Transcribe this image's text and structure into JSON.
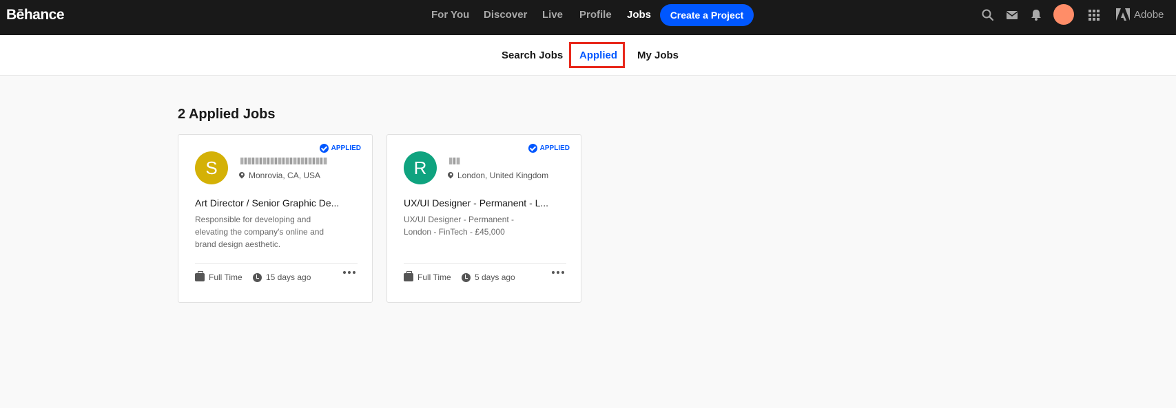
{
  "topbar": {
    "logo": "Bēhance",
    "nav": [
      "For You",
      "Discover",
      "Live",
      "Profile",
      "Jobs"
    ],
    "create_label": "Create a Project",
    "adobe_label": "Adobe",
    "colors": {
      "bg": "#191919",
      "accent": "#0057ff",
      "avatar": "#ff8d68"
    }
  },
  "subnav": {
    "items": [
      "Search Jobs",
      "Applied",
      "My Jobs"
    ],
    "active": "Applied"
  },
  "main": {
    "heading": "2 Applied Jobs",
    "cards": [
      {
        "badge": "APPLIED",
        "avatar_letter": "S",
        "avatar_color": "#d4b106",
        "location": "Monrovia, CA, USA",
        "title": "Art Director / Senior Graphic De...",
        "description": "Responsible for developing and elevating the company's online and brand design aesthetic.",
        "type": "Full Time",
        "posted": "15 days ago"
      },
      {
        "badge": "APPLIED",
        "avatar_letter": "R",
        "avatar_color": "#0fa37f",
        "location": "London, United Kingdom",
        "title": "UX/UI Designer - Permanent - L...",
        "description": "UX/UI Designer - Permanent - London - FinTech - £45,000",
        "type": "Full Time",
        "posted": "5 days ago"
      }
    ]
  }
}
